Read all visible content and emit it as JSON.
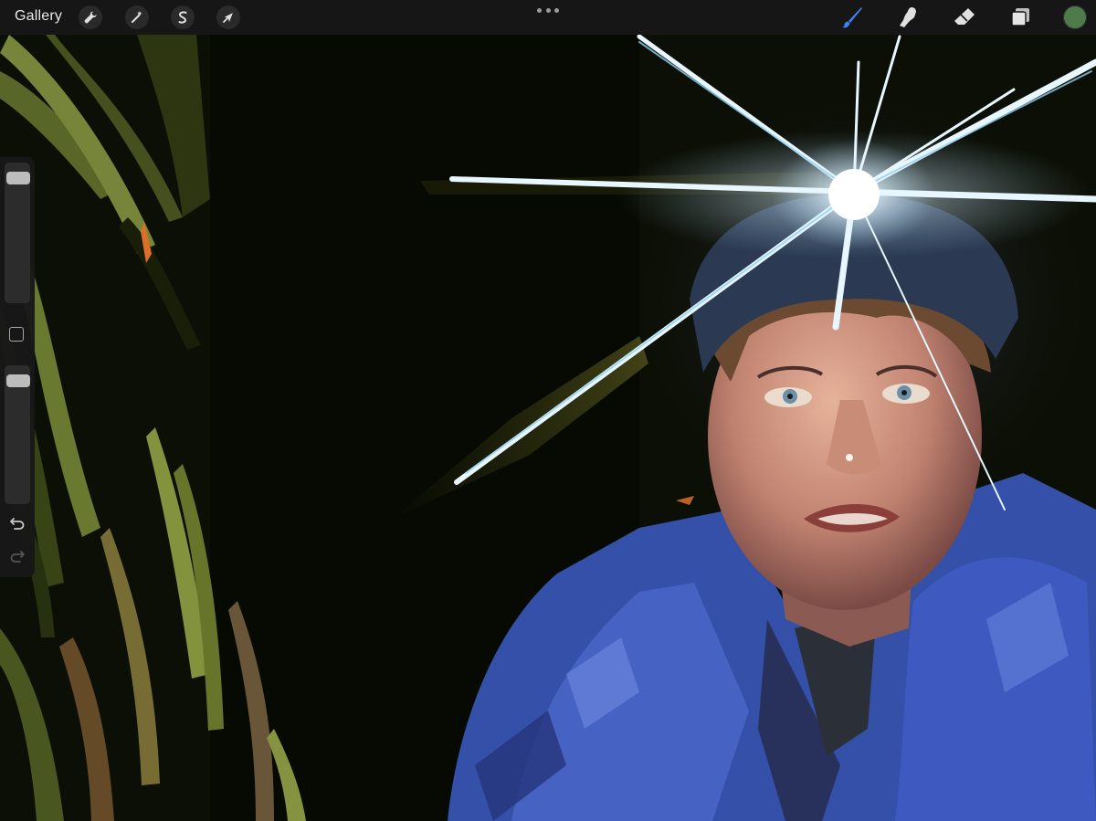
{
  "toolbar": {
    "gallery_label": "Gallery",
    "left_tools": [
      {
        "name": "actions",
        "icon": "wrench-icon"
      },
      {
        "name": "adjustments",
        "icon": "magic-wand-icon"
      },
      {
        "name": "selection",
        "icon": "selection-s-icon"
      },
      {
        "name": "transform",
        "icon": "arrow-cursor-icon"
      }
    ],
    "more_icon": "ellipsis-icon",
    "right_tools": [
      {
        "name": "brush",
        "icon": "brush-icon",
        "active": true
      },
      {
        "name": "smudge",
        "icon": "smudge-finger-icon",
        "active": false
      },
      {
        "name": "eraser",
        "icon": "eraser-icon",
        "active": false
      },
      {
        "name": "layers",
        "icon": "layers-icon",
        "active": false
      }
    ],
    "active_tool_color": "#3b82f6",
    "current_color": "#4f7a4a"
  },
  "sidebar": {
    "brush_size": 0.95,
    "brush_opacity": 0.95,
    "modify_icon": "square-icon",
    "undo_icon": "undo-icon",
    "redo_icon": "redo-icon"
  },
  "canvas": {
    "subject": "digital-painting-portrait",
    "palette": {
      "background": "#0b0f05",
      "foliage_light": "#7a8a38",
      "foliage_dark": "#262e12",
      "jacket": "#3b56b8",
      "skin": "#c9907a",
      "glow": "#d8f1ff"
    }
  }
}
